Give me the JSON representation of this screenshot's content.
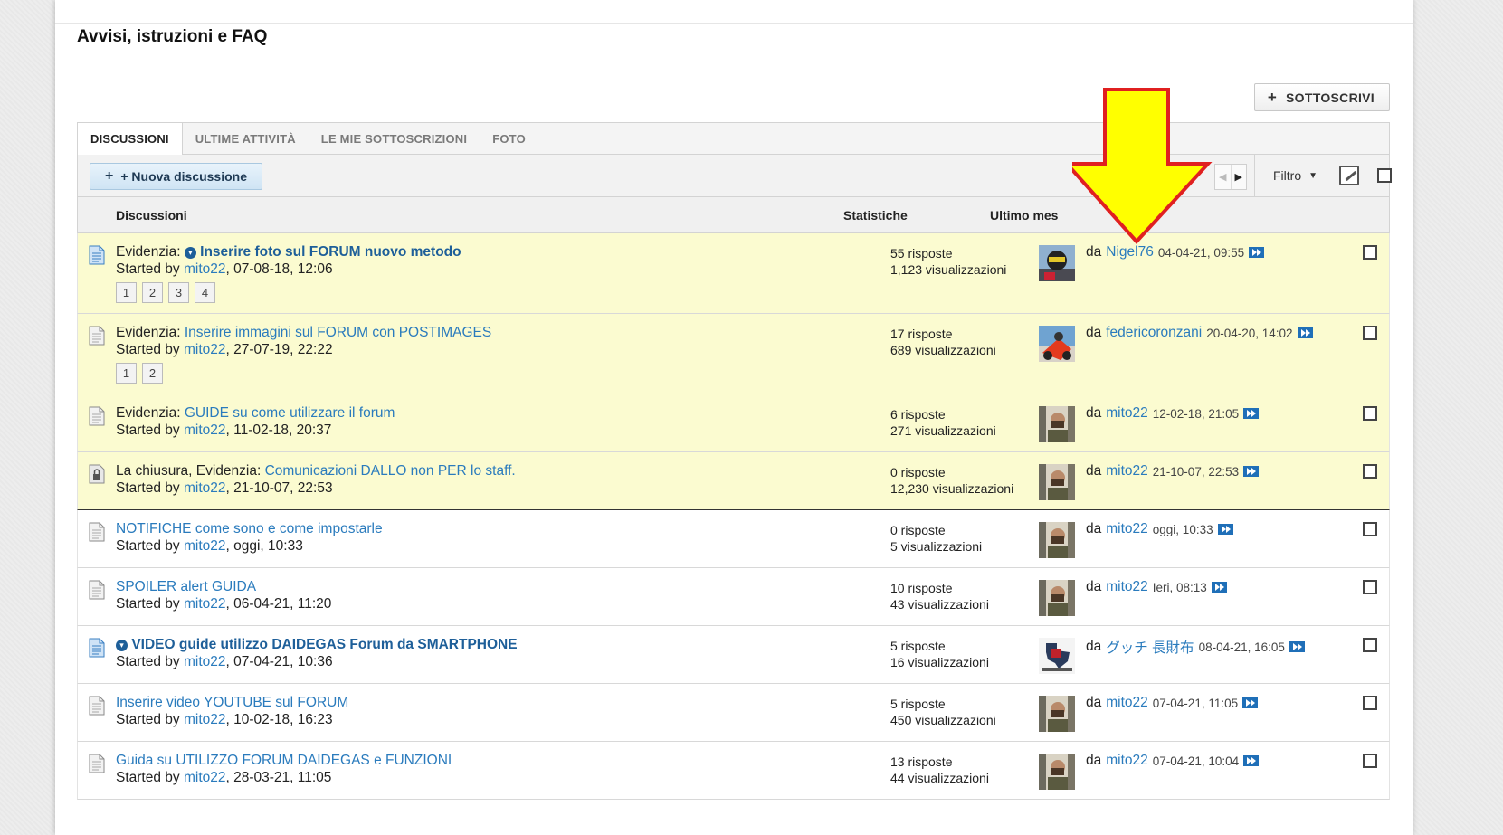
{
  "page_title": "Avvisi, istruzioni e FAQ",
  "subscribe_label": "SOTTOSCRIVI",
  "tabs": [
    {
      "label": "DISCUSSIONI",
      "active": true
    },
    {
      "label": "ULTIME ATTIVITÀ",
      "active": false
    },
    {
      "label": "LE MIE SOTTOSCRIZIONI",
      "active": false
    },
    {
      "label": "FOTO",
      "active": false
    }
  ],
  "toolbar": {
    "new_discussion_label": "+ Nuova discussione",
    "filter_label": "Filtro"
  },
  "columns": {
    "discussions": "Discussioni",
    "stats": "Statistiche",
    "last_post": "Ultimo mes"
  },
  "colors": {
    "sticky_bg": "#fbfbd0",
    "link": "#2a7bbd",
    "arrow_fill": "#ffff00",
    "arrow_stroke": "#e02020"
  },
  "threads": [
    {
      "sticky": true,
      "prefix": "Evidenzia:",
      "has_badge": true,
      "bold": true,
      "title": "Inserire foto sul FORUM nuovo metodo",
      "started_label": "Started by",
      "author": "mito22",
      "started_date": ", 07-08-18, 12:06",
      "pages": [
        "1",
        "2",
        "3",
        "4"
      ],
      "replies": "55 risposte",
      "views": "1,123 visualizzazioni",
      "last_prefix": "da",
      "last_user": "Nigel76",
      "last_date": "04-04-21, 09:55",
      "avatar": "helmet-avatar",
      "icon": "doc-blue-icon"
    },
    {
      "sticky": true,
      "prefix": "Evidenzia:",
      "has_badge": false,
      "bold": false,
      "title": "Inserire immagini sul FORUM con POSTIMAGES",
      "started_label": "Started by",
      "author": "mito22",
      "started_date": ", 27-07-19, 22:22",
      "pages": [
        "1",
        "2"
      ],
      "replies": "17 risposte",
      "views": "689 visualizzazioni",
      "last_prefix": "da",
      "last_user": "federicoronzani",
      "last_date": "20-04-20, 14:02",
      "avatar": "moto-avatar",
      "icon": "doc-gray-icon"
    },
    {
      "sticky": true,
      "prefix": "Evidenzia:",
      "has_badge": false,
      "bold": false,
      "title": "GUIDE su come utilizzare il forum",
      "started_label": "Started by",
      "author": "mito22",
      "started_date": ", 11-02-18, 20:37",
      "pages": [],
      "replies": "6 risposte",
      "views": "271 visualizzazioni",
      "last_prefix": "da",
      "last_user": "mito22",
      "last_date": "12-02-18, 21:05",
      "avatar": "man-avatar",
      "icon": "doc-gray-icon"
    },
    {
      "sticky": true,
      "prefix": "La chiusura, Evidenzia:",
      "has_badge": false,
      "bold": false,
      "title": "Comunicazioni DALLO non PER lo staff.",
      "started_label": "Started by",
      "author": "mito22",
      "started_date": ", 21-10-07, 22:53",
      "pages": [],
      "replies": "0 risposte",
      "views": "12,230 visualizzazioni",
      "last_prefix": "da",
      "last_user": "mito22",
      "last_date": "21-10-07, 22:53",
      "avatar": "man-avatar",
      "icon": "lock-icon"
    },
    {
      "sticky": false,
      "prefix": "",
      "has_badge": false,
      "bold": false,
      "title": "NOTIFICHE come sono e come impostarle",
      "started_label": "Started by",
      "author": "mito22",
      "started_date": ", oggi, 10:33",
      "pages": [],
      "replies": "0 risposte",
      "views": "5 visualizzazioni",
      "last_prefix": "da",
      "last_user": "mito22",
      "last_date": "oggi, 10:33",
      "avatar": "man-avatar",
      "icon": "doc-gray-icon"
    },
    {
      "sticky": false,
      "prefix": "",
      "has_badge": false,
      "bold": false,
      "title": "SPOILER alert GUIDA",
      "started_label": "Started by",
      "author": "mito22",
      "started_date": ", 06-04-21, 11:20",
      "pages": [],
      "replies": "10 risposte",
      "views": "43 visualizzazioni",
      "last_prefix": "da",
      "last_user": "mito22",
      "last_date": "Ieri, 08:13",
      "avatar": "man-avatar",
      "icon": "doc-gray-icon"
    },
    {
      "sticky": false,
      "prefix": "",
      "has_badge": true,
      "bold": true,
      "title": "VIDEO guide utilizzo DAIDEGAS Forum da SMARTPHONE",
      "started_label": "Started by",
      "author": "mito22",
      "started_date": ", 07-04-21, 10:36",
      "pages": [],
      "replies": "5 risposte",
      "views": "16 visualizzazioni",
      "last_prefix": "da",
      "last_user": "グッチ 長財布",
      "last_date": "08-04-21, 16:05",
      "avatar": "texas-avatar",
      "icon": "doc-blue-icon"
    },
    {
      "sticky": false,
      "prefix": "",
      "has_badge": false,
      "bold": false,
      "title": "Inserire video YOUTUBE sul FORUM",
      "started_label": "Started by",
      "author": "mito22",
      "started_date": ", 10-02-18, 16:23",
      "pages": [],
      "replies": "5 risposte",
      "views": "450 visualizzazioni",
      "last_prefix": "da",
      "last_user": "mito22",
      "last_date": "07-04-21, 11:05",
      "avatar": "man-avatar",
      "icon": "doc-gray-icon"
    },
    {
      "sticky": false,
      "prefix": "",
      "has_badge": false,
      "bold": false,
      "title": "Guida su UTILIZZO FORUM DAIDEGAS e FUNZIONI",
      "started_label": "Started by",
      "author": "mito22",
      "started_date": ", 28-03-21, 11:05",
      "pages": [],
      "replies": "13 risposte",
      "views": "44 visualizzazioni",
      "last_prefix": "da",
      "last_user": "mito22",
      "last_date": "07-04-21, 10:04",
      "avatar": "man-avatar",
      "icon": "doc-gray-icon"
    }
  ]
}
